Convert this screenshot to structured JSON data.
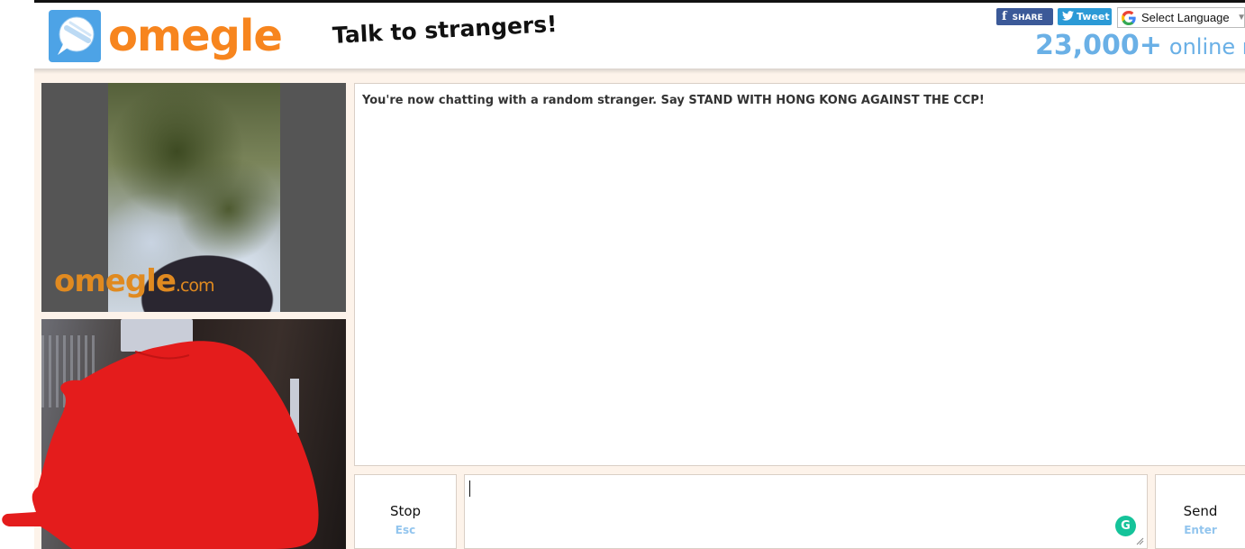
{
  "header": {
    "logo_text": "omegle",
    "tagline": "Talk to strangers!",
    "share_facebook": "SHARE",
    "share_twitter": "Tweet",
    "language_select": "Select Language",
    "online_count": "23,000+",
    "online_label": "online now"
  },
  "video": {
    "stranger_watermark": "omegle",
    "stranger_watermark_suffix": ".com",
    "self_redacted": true
  },
  "chat": {
    "status_message": "You're now chatting with a random stranger. Say STAND WITH HONG KONG AGAINST THE CCP!"
  },
  "controls": {
    "stop_label": "Stop",
    "stop_hint": "Esc",
    "message_value": "",
    "send_label": "Send",
    "send_hint": "Enter"
  },
  "icons": {
    "logo": "omegle-logo-icon",
    "facebook": "facebook-icon",
    "twitter": "twitter-icon",
    "google": "google-icon",
    "grammarly": "grammarly-icon",
    "resize": "resize-grip-icon"
  },
  "colors": {
    "brand_orange": "#f7851e",
    "brand_blue": "#4da3e6",
    "online_blue": "#6ab0e6",
    "background": "#fdf3ea",
    "redaction": "#e41c1c"
  }
}
